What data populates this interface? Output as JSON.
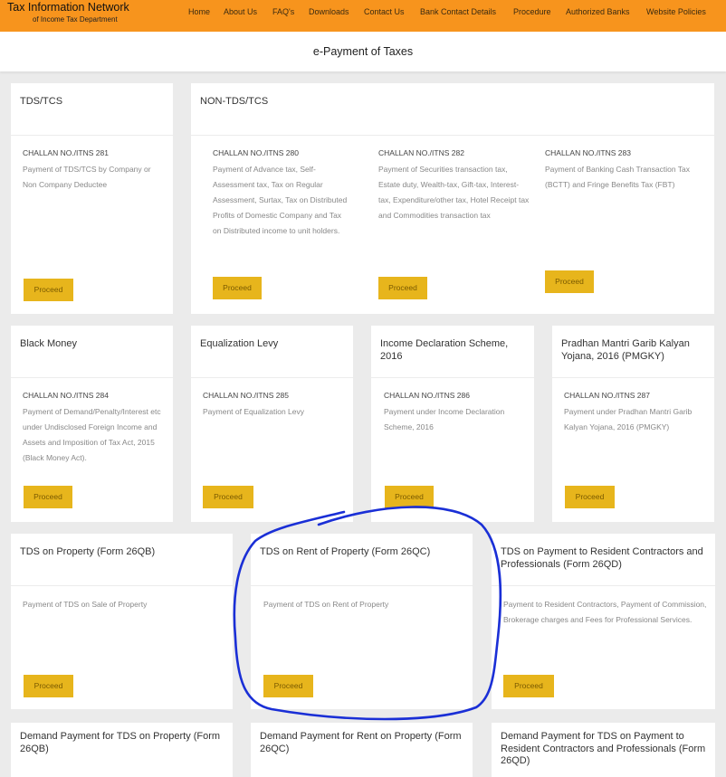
{
  "brand": {
    "title": "Tax Information Network",
    "subtitle": "of Income Tax Department"
  },
  "nav": [
    "Home",
    "About Us",
    "FAQ's",
    "Downloads",
    "Contact Us",
    "Bank Contact Details",
    "Procedure",
    "Authorized Banks",
    "Website Policies"
  ],
  "page_title": "e-Payment of Taxes",
  "proceed_label": "Proceed",
  "sections": {
    "tds_tcs": {
      "heading": "TDS/TCS",
      "challan": "CHALLAN NO./ITNS 281",
      "desc": "Payment of TDS/TCS by Company or Non Company Deductee"
    },
    "non_tds": {
      "heading": "NON-TDS/TCS",
      "items": [
        {
          "challan": "CHALLAN NO./ITNS 280",
          "desc": "Payment of Advance tax, Self-Assessment tax, Tax on Regular Assessment, Surtax, Tax on Distributed Profits of Domestic Company and Tax on Distributed income to unit holders."
        },
        {
          "challan": "CHALLAN NO./ITNS 282",
          "desc": "Payment of Securities transaction tax, Estate duty, Wealth-tax, Gift-tax, Interest-tax, Expenditure/other tax, Hotel Receipt tax and Commodities transaction tax"
        },
        {
          "challan": "CHALLAN NO./ITNS 283",
          "desc": "Payment of Banking Cash Transaction Tax (BCTT) and Fringe Benefits Tax (FBT)"
        }
      ]
    },
    "row2": [
      {
        "title": "Black Money",
        "challan": "CHALLAN NO./ITNS 284",
        "desc": "Payment of Demand/Penalty/Interest etc under Undisclosed Foreign Income and Assets and Imposition of Tax Act, 2015 (Black Money Act)."
      },
      {
        "title": "Equalization Levy",
        "challan": "CHALLAN NO./ITNS 285",
        "desc": "Payment of Equalization Levy"
      },
      {
        "title": "Income Declaration Scheme, 2016",
        "challan": "CHALLAN NO./ITNS 286",
        "desc": "Payment under Income Declaration Scheme, 2016"
      },
      {
        "title": "Pradhan Mantri Garib Kalyan Yojana, 2016 (PMGKY)",
        "challan": "CHALLAN NO./ITNS 287",
        "desc": "Payment under Pradhan Mantri Garib Kalyan Yojana, 2016 (PMGKY)"
      }
    ],
    "row3": [
      {
        "title": "TDS on Property (Form 26QB)",
        "desc": "Payment of TDS on Sale of Property"
      },
      {
        "title": "TDS on Rent of Property (Form 26QC)",
        "desc": "Payment of TDS on Rent of Property"
      },
      {
        "title": "TDS on Payment to Resident Contractors and Professionals (Form 26QD)",
        "desc": "Payment to Resident Contractors, Payment of Commission, Brokerage charges and Fees for Professional Services."
      }
    ],
    "row4": [
      {
        "title": "Demand Payment for TDS on Property (Form 26QB)"
      },
      {
        "title": "Demand Payment for Rent on Property (Form 26QC)"
      },
      {
        "title": "Demand Payment for TDS on Payment to Resident Contractors and Professionals (Form 26QD)"
      }
    ]
  },
  "colors": {
    "topbar": "#f7941d",
    "button": "#e7b51c",
    "annotation": "#1a2fd6"
  }
}
